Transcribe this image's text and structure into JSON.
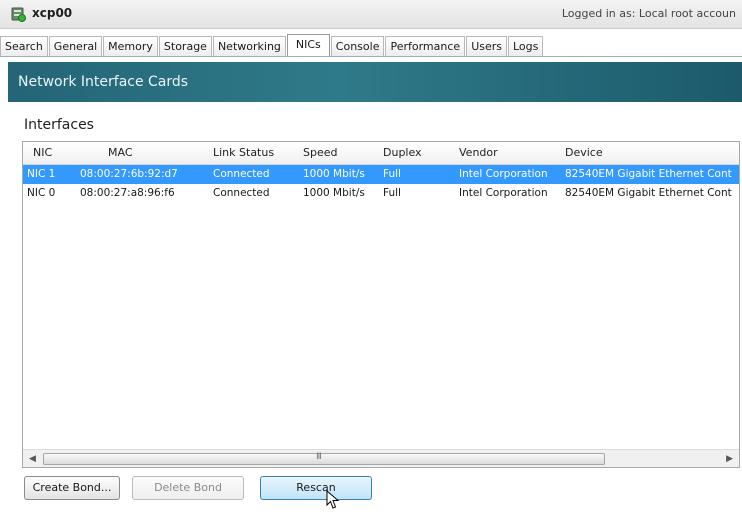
{
  "window": {
    "host_name": "xcp00",
    "logged_in_text": "Logged in as:  Local root accoun"
  },
  "tabs": [
    {
      "label": "Search"
    },
    {
      "label": "General"
    },
    {
      "label": "Memory"
    },
    {
      "label": "Storage"
    },
    {
      "label": "Networking"
    },
    {
      "label": "NICs",
      "active": true
    },
    {
      "label": "Console"
    },
    {
      "label": "Performance"
    },
    {
      "label": "Users"
    },
    {
      "label": "Logs"
    }
  ],
  "banner": {
    "title": "Network Interface Cards"
  },
  "section": {
    "title": "Interfaces"
  },
  "table": {
    "columns": [
      "NIC",
      "MAC",
      "Link Status",
      "Speed",
      "Duplex",
      "Vendor",
      "Device"
    ],
    "rows": [
      {
        "nic": "NIC 1",
        "mac": "08:00:27:6b:92:d7",
        "link_status": "Connected",
        "speed": "1000 Mbit/s",
        "duplex": "Full",
        "vendor": "Intel Corporation",
        "device": "82540EM Gigabit Ethernet Cont",
        "selected": true
      },
      {
        "nic": "NIC 0",
        "mac": "08:00:27:a8:96:f6",
        "link_status": "Connected",
        "speed": "1000 Mbit/s",
        "duplex": "Full",
        "vendor": "Intel Corporation",
        "device": "82540EM Gigabit Ethernet Cont",
        "selected": false
      }
    ]
  },
  "buttons": {
    "create_bond": "Create Bond...",
    "delete_bond": "Delete Bond",
    "rescan": "Rescan"
  },
  "scrollbar": {
    "grip": "III"
  },
  "colors": {
    "selection": "#3399ff",
    "banner": "#246576",
    "button_hover": "#bfe3f8"
  },
  "icons": [
    "host-icon",
    "scroll-left-icon",
    "scroll-right-icon",
    "mouse-cursor-icon"
  ]
}
